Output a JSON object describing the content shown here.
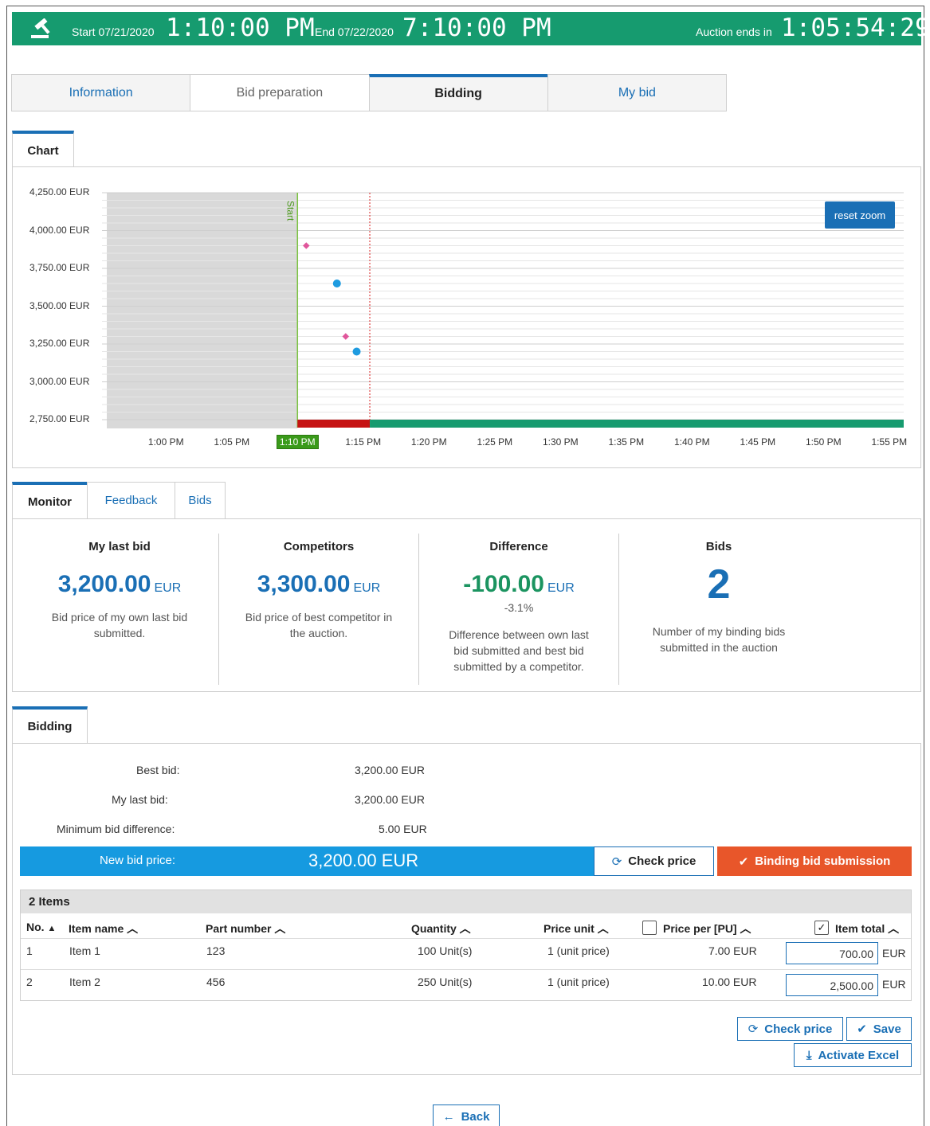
{
  "header": {
    "start_label": "Start 07/21/2020",
    "start_time": "1:10:00 PM",
    "end_label": "End 07/22/2020",
    "end_time": "7:10:00 PM",
    "ends_label": "Auction ends in",
    "countdown": "1:05:54:29",
    "icon": "gavel-icon",
    "color": "#169b6f"
  },
  "tabs": [
    "Information",
    "Bid preparation",
    "Bidding",
    "My bid"
  ],
  "chart_panel": {
    "tab": "Chart",
    "reset_zoom": "reset zoom",
    "start_marker": "Start",
    "current_time_marker": "1:10 PM"
  },
  "chart_data": {
    "type": "scatter",
    "y_ticks": [
      "4,250.00 EUR",
      "4,000.00 EUR",
      "3,750.00 EUR",
      "3,500.00 EUR",
      "3,250.00 EUR",
      "3,000.00 EUR",
      "2,750.00 EUR"
    ],
    "x_ticks": [
      "1:00 PM",
      "1:05 PM",
      "1:10 PM",
      "1:15 PM",
      "1:20 PM",
      "1:25 PM",
      "1:30 PM",
      "1:35 PM",
      "1:40 PM",
      "1:45 PM",
      "1:50 PM",
      "1:55 PM"
    ],
    "ylim": [
      2750,
      4250
    ],
    "series": [
      {
        "color": "#e0569b",
        "marker": "diamond",
        "points": [
          {
            "x": "1:10:40 PM",
            "y": 3900
          },
          {
            "x": "1:13:40 PM",
            "y": 3300
          }
        ]
      },
      {
        "color": "#1e9be0",
        "marker": "circle",
        "points": [
          {
            "x": "1:13:00 PM",
            "y": 3650
          },
          {
            "x": "1:14:30 PM",
            "y": 3200
          }
        ]
      }
    ]
  },
  "monitor": {
    "tabs": [
      "Monitor",
      "Feedback",
      "Bids"
    ],
    "my_last_bid": {
      "title": "My last bid",
      "value": "3,200.00",
      "unit": "EUR",
      "desc": "Bid price of my own last bid submitted."
    },
    "competitors": {
      "title": "Competitors",
      "value": "3,300.00",
      "unit": "EUR",
      "desc": "Bid price of best competitor in the auction."
    },
    "difference": {
      "title": "Difference",
      "value": "-100.00",
      "unit": "EUR",
      "percent": "-3.1%",
      "desc": "Difference between own last bid submitted and best bid submitted by a competitor."
    },
    "bids": {
      "title": "Bids",
      "value": "2",
      "desc": "Number of my binding bids submitted in the auction"
    }
  },
  "bidding": {
    "tab": "Bidding",
    "best_bid_label": "Best bid:",
    "best_bid": "3,200.00 EUR",
    "my_last_bid_label": "My last bid:",
    "my_last_bid": "3,200.00 EUR",
    "min_diff_label": "Minimum bid difference:",
    "min_diff": "5.00 EUR",
    "new_bid_label": "New bid price:",
    "new_bid": "3,200.00 EUR",
    "check_price": "Check price",
    "binding_submission": "Binding bid submission",
    "items_caption": "2 Items",
    "columns": [
      "No.",
      "Item name",
      "Part number",
      "Quantity",
      "Price unit",
      "Price per [PU]",
      "Item total"
    ],
    "rows": [
      {
        "no": "1",
        "name": "Item 1",
        "part": "123",
        "qty": "100 Unit(s)",
        "unit": "1 (unit price)",
        "price": "7.00 EUR",
        "total": "700.00",
        "cur": "EUR"
      },
      {
        "no": "2",
        "name": "Item 2",
        "part": "456",
        "qty": "250 Unit(s)",
        "unit": "1 (unit price)",
        "price": "10.00 EUR",
        "total": "2,500.00",
        "cur": "EUR"
      }
    ],
    "check_price_btn": "Check price",
    "save_btn": "Save",
    "activate_excel_btn": "Activate Excel"
  },
  "back": "Back"
}
